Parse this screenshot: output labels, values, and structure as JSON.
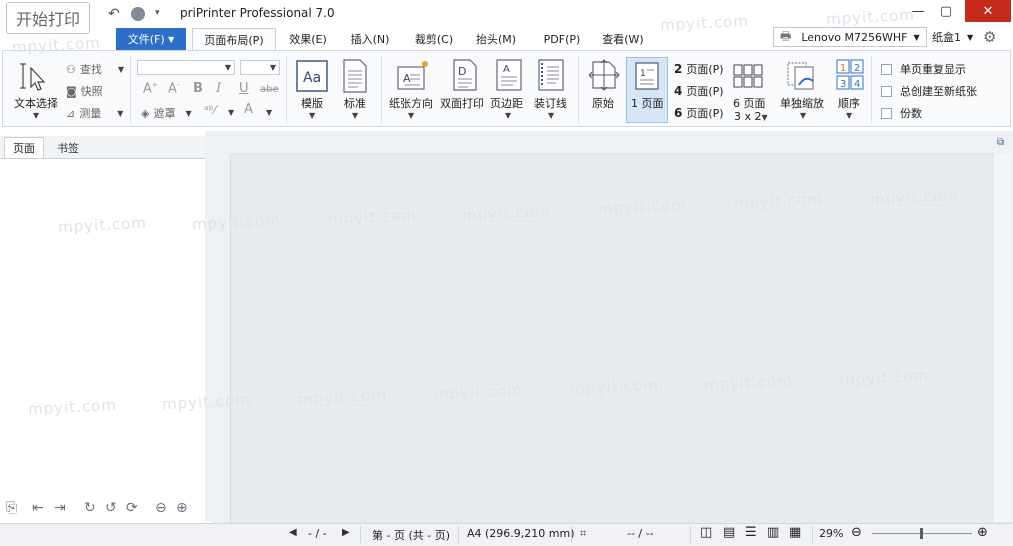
{
  "app": {
    "title": "priPrinter Professional 7.0",
    "start_button": "开始打印"
  },
  "tabs": [
    {
      "label": "文件(F)"
    },
    {
      "label": "页面布局(P)"
    },
    {
      "label": "效果(E)"
    },
    {
      "label": "插入(N)"
    },
    {
      "label": "裁剪(C)"
    },
    {
      "label": "抬头(M)"
    },
    {
      "label": "PDF(P)"
    },
    {
      "label": "查看(W)"
    }
  ],
  "printer": {
    "name": "Lenovo M7256WHF",
    "tray": "纸盒1"
  },
  "ribbon": {
    "select_tool": "文本选择",
    "find": "查找",
    "snapshot": "快照",
    "measure": "测量",
    "mask": "遮罩",
    "template": "模版",
    "stamp": "标准",
    "orientation": "纸张方向",
    "duplex": "双面打印",
    "margins": "页边距",
    "binding": "装订线",
    "original": "原始",
    "one_page": "1 页面",
    "pages_2": {
      "num": "2",
      "label": "页面(P)"
    },
    "pages_4": {
      "num": "4",
      "label": "页面(P)"
    },
    "pages_6": {
      "num": "6",
      "label": "页面(P)"
    },
    "pages_6_grid": "6 页面",
    "grid_size": "3 x 2",
    "scale_single": "单独缩放",
    "order": "顺序",
    "order_nums": [
      "1",
      "2",
      "3",
      "4"
    ],
    "check_repeat": "单页重复显示",
    "check_new_sheet": "总创建至新纸张",
    "check_copies": "份数"
  },
  "left_panel": {
    "tab_page": "页面",
    "tab_bookmark": "书签"
  },
  "watermark": "mpyit.com",
  "status": {
    "page_nav": "- / -",
    "page_info": "第 - 页 (共 - 页)",
    "paper": "A4 (296.9,210 mm)",
    "position": "-- / --",
    "zoom": "29%"
  }
}
